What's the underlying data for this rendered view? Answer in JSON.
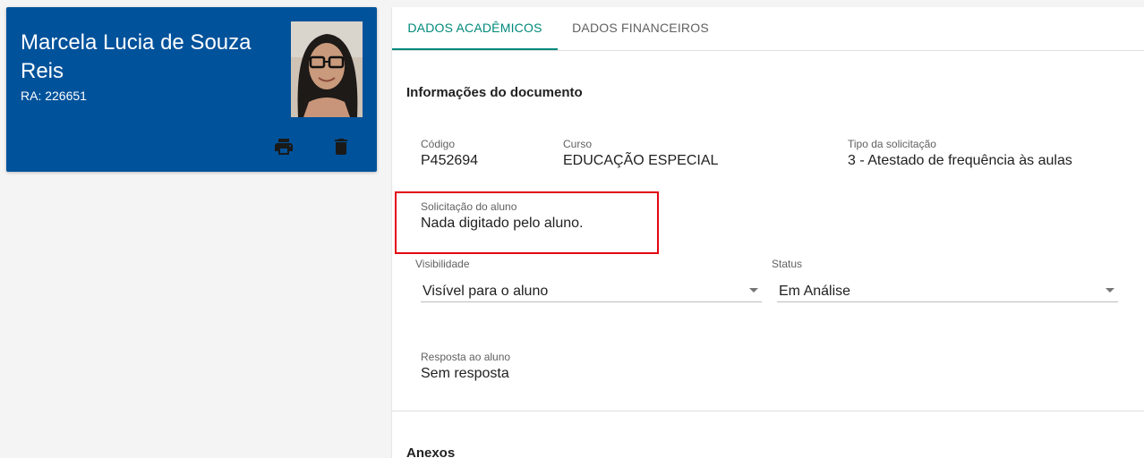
{
  "student": {
    "name": "Marcela Lucia de Souza Reis",
    "ra": "RA: 226651",
    "photo_icon": "student-photo",
    "actions": {
      "print_icon": "print-icon",
      "delete_icon": "delete-icon"
    }
  },
  "tabs": [
    {
      "label": "DADOS ACADÊMICOS",
      "active": true
    },
    {
      "label": "DADOS FINANCEIROS",
      "active": false
    }
  ],
  "document": {
    "section_title": "Informações do documento",
    "codigo": {
      "label": "Código",
      "value": "P452694"
    },
    "curso": {
      "label": "Curso",
      "value": "EDUCAÇÃO ESPECIAL"
    },
    "tipo": {
      "label": "Tipo da solicitação",
      "value": "3 - Atestado de frequência às aulas"
    },
    "solicitacao": {
      "label": "Solicitação do aluno",
      "value": "Nada digitado pelo aluno."
    },
    "visibilidade": {
      "label": "Visibilidade",
      "value": "Visível para o aluno"
    },
    "status": {
      "label": "Status",
      "value": "Em Análise"
    },
    "resposta": {
      "label": "Resposta ao aluno",
      "value": "Sem resposta"
    }
  },
  "anexos": {
    "title": "Anexos"
  },
  "colors": {
    "card_background": "#00529b",
    "active_tab": "#00897b",
    "highlight_border": "#e30613"
  }
}
